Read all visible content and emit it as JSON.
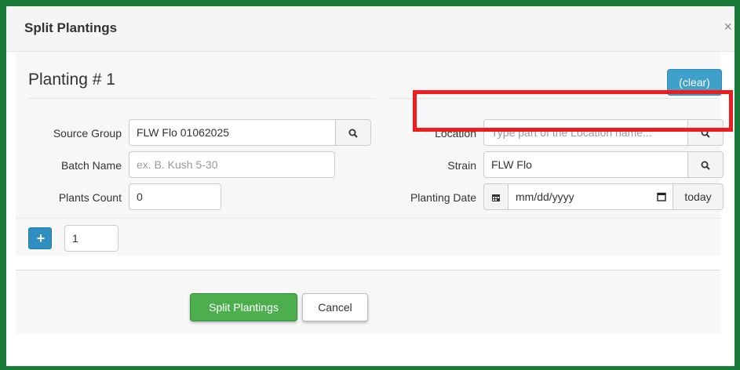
{
  "modal": {
    "title": "Split Plantings",
    "close_glyph": "×"
  },
  "planting": {
    "heading": "Planting # 1",
    "clear_label": "(clear)"
  },
  "fields": {
    "source_group": {
      "label": "Source Group",
      "value": "FLW Flo 01062025"
    },
    "batch_name": {
      "label": "Batch Name",
      "placeholder": "ex. B. Kush 5-30"
    },
    "plants_count": {
      "label": "Plants Count",
      "value": "0"
    },
    "location": {
      "label": "Location",
      "placeholder": "Type part of the Location name..."
    },
    "strain": {
      "label": "Strain",
      "value": "FLW Flo"
    },
    "planting_date": {
      "label": "Planting Date",
      "placeholder": "mm/dd/yyyy",
      "today_label": "today"
    }
  },
  "add_rows": {
    "plus_label": "+",
    "count_value": "1"
  },
  "footer": {
    "split_label": "Split Plantings",
    "cancel_label": "Cancel"
  },
  "colors": {
    "frame": "#1a7a3a",
    "highlight": "#ee1c1c",
    "clear_button": "#3fa0c9",
    "split_button": "#4cae4c",
    "plus_button": "#2f8fc0"
  }
}
